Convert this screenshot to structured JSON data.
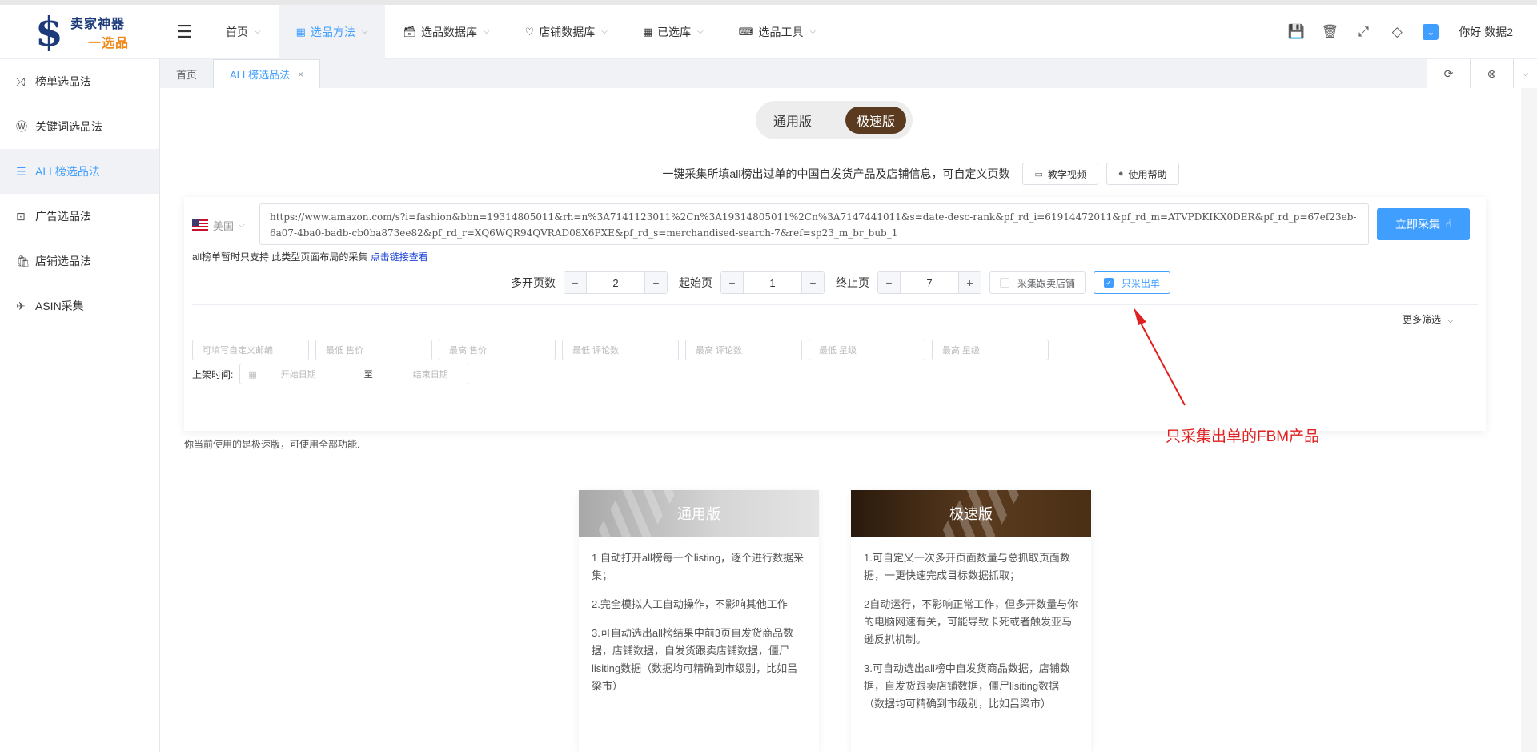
{
  "logo": {
    "line1": "卖家神器",
    "line2": "一选品",
    "mark": "$"
  },
  "nav": [
    {
      "label": "首页",
      "icon": "",
      "active": false
    },
    {
      "label": "选品方法",
      "icon": "▦",
      "active": true
    },
    {
      "label": "选品数据库",
      "icon": "🗃",
      "active": false
    },
    {
      "label": "店铺数据库",
      "icon": "♡",
      "active": false
    },
    {
      "label": "已选库",
      "icon": "▦",
      "active": false
    },
    {
      "label": "选品工具",
      "icon": "⌨",
      "active": false
    }
  ],
  "header": {
    "greeting": "你好 数据2"
  },
  "sidebar": [
    {
      "label": "榜单选品法",
      "icon": "⤮",
      "active": false
    },
    {
      "label": "关键词选品法",
      "icon": "Ⓦ",
      "active": false
    },
    {
      "label": "ALL榜选品法",
      "icon": "☰",
      "active": true
    },
    {
      "label": "广告选品法",
      "icon": "⊡",
      "active": false
    },
    {
      "label": "店铺选品法",
      "icon": "🛍",
      "active": false
    },
    {
      "label": "ASIN采集",
      "icon": "✈",
      "active": false
    }
  ],
  "tabs": [
    {
      "label": "首页",
      "active": false
    },
    {
      "label": "ALL榜选品法",
      "active": true
    }
  ],
  "version_toggle": {
    "normal": "通用版",
    "fast": "极速版"
  },
  "description": "一键采集所填all榜出过单的中国自发货产品及店铺信息，可自定义页数",
  "buttons": {
    "tutorial": "教学视频",
    "help": "使用帮助",
    "collect": "立即采集"
  },
  "country": "美国",
  "url": "https://www.amazon.com/s?i=fashion&bbn=19314805011&rh=n%3A7141123011%2Cn%3A19314805011%2Cn%3A7147441011&s=date-desc-rank&pf_rd_i=61914472011&pf_rd_m=ATVPDKIKX0DER&pf_rd_p=67ef23eb-6a07-4ba0-badb-cb0ba873ee82&pf_rd_r=XQ6WQR94QVRAD08X6PXE&pf_rd_s=merchandised-search-7&ref=sp23_m_br_bub_1",
  "support": {
    "text": "all榜单暂时只支持 此类型页面布局的采集 ",
    "link": "点击链接查看"
  },
  "pager": {
    "multi_label": "多开页数",
    "multi_value": "2",
    "start_label": "起始页",
    "start_value": "1",
    "end_label": "终止页",
    "end_value": "7",
    "follow_shop": "采集跟卖店铺",
    "only_orders": "只采出单"
  },
  "more_filter": "更多筛选",
  "filters": [
    "可填写自定义邮编",
    "最低 售价",
    "最高 售价",
    "最低 评论数",
    "最高 评论数",
    "最低 星级",
    "最高 星级"
  ],
  "date": {
    "label": "上架时间:",
    "start": "开始日期",
    "to": "至",
    "end": "结束日期"
  },
  "annotation": "只采集出单的FBM产品",
  "notice": "你当前使用的是极速版，可使用全部功能.",
  "cards": {
    "normal": {
      "title": "通用版",
      "items": [
        "1 自动打开all榜每一个listing，逐个进行数据采集；",
        "2.完全模拟人工自动操作，不影响其他工作",
        "3.可自动选出all榜结果中前3页自发货商品数据，店铺数据，自发货跟卖店铺数据，僵尸lisiting数据（数据均可精确到市级别，比如吕梁市）"
      ]
    },
    "fast": {
      "title": "极速版",
      "items": [
        "1.可自定义一次多开页面数量与总抓取页面数据，一更快速完成目标数据抓取；",
        "2自动运行，不影响正常工作，但多开数量与你的电脑网速有关，可能导致卡死或者触发亚马逊反扒机制。",
        "3.可自动选出all榜中自发货商品数据，店铺数据，自发货跟卖店铺数据，僵尸lisiting数据（数据均可精确到市级别，比如吕梁市）"
      ]
    }
  }
}
